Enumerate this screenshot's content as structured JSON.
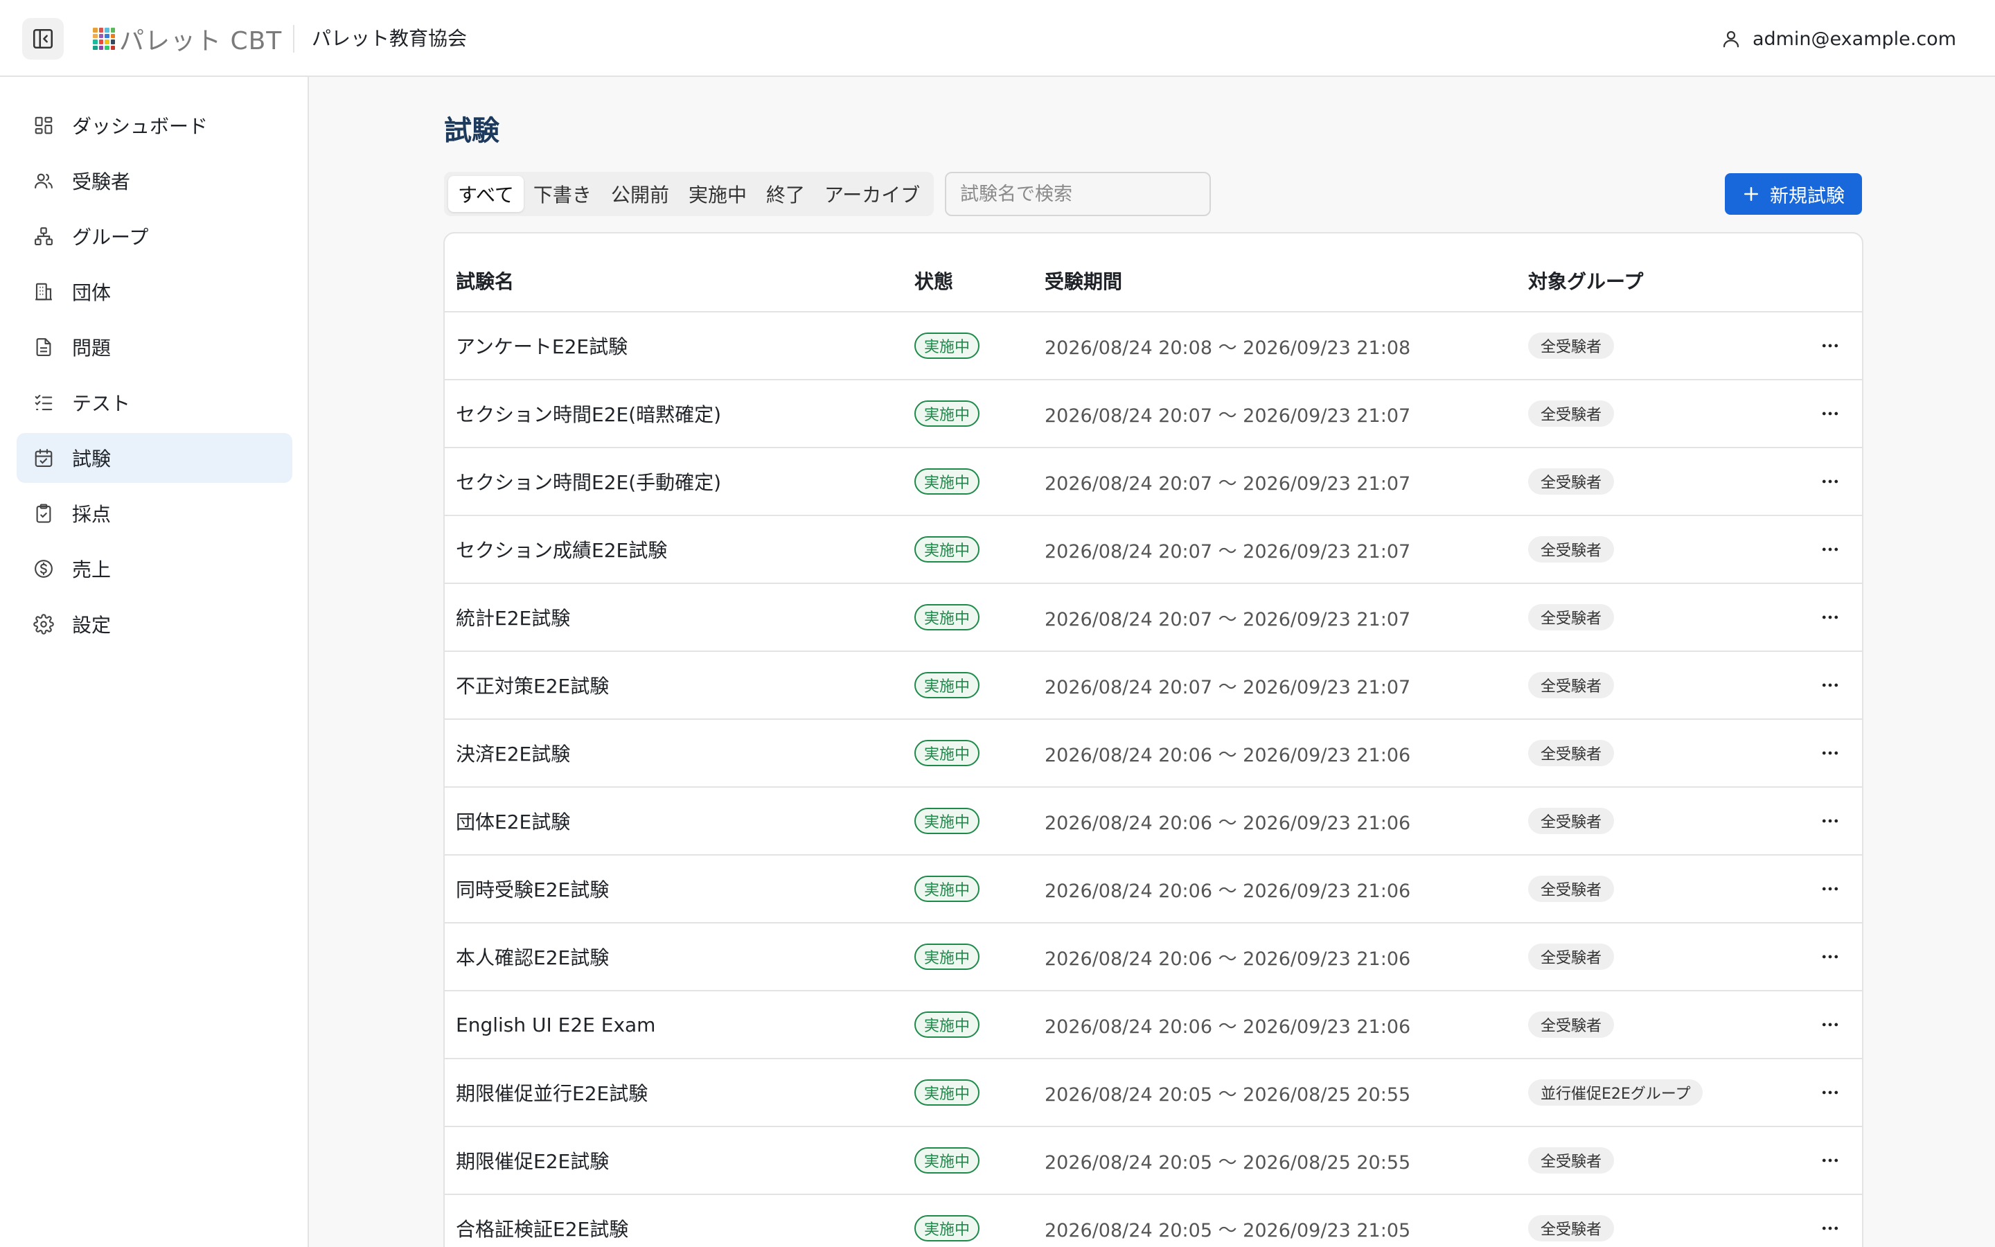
{
  "header": {
    "logo_text": "パレット CBT",
    "org_name": "パレット教育協会",
    "user_email": "admin@example.com"
  },
  "sidebar": {
    "items": [
      {
        "label": "ダッシュボード",
        "icon": "dashboard-icon"
      },
      {
        "label": "受験者",
        "icon": "users-icon"
      },
      {
        "label": "グループ",
        "icon": "group-icon"
      },
      {
        "label": "団体",
        "icon": "building-icon"
      },
      {
        "label": "問題",
        "icon": "document-icon"
      },
      {
        "label": "テスト",
        "icon": "checklist-icon"
      },
      {
        "label": "試験",
        "icon": "calendar-icon"
      },
      {
        "label": "採点",
        "icon": "clipboard-check-icon"
      },
      {
        "label": "売上",
        "icon": "dollar-icon"
      },
      {
        "label": "設定",
        "icon": "gear-icon"
      }
    ],
    "active_item": "試験"
  },
  "main": {
    "title": "試験",
    "tabs": [
      "すべて",
      "下書き",
      "公開前",
      "実施中",
      "終了",
      "アーカイブ"
    ],
    "active_tab": "すべて",
    "search_placeholder": "試験名で検索",
    "new_button_label": "新規試験",
    "table": {
      "columns": [
        "試験名",
        "状態",
        "受験期間",
        "対象グループ"
      ],
      "rows": [
        {
          "name": "アンケートE2E試験",
          "status": "実施中",
          "period": "2026/08/24 20:08 〜 2026/09/23 21:08",
          "group": "全受験者"
        },
        {
          "name": "セクション時間E2E(暗黙確定)",
          "status": "実施中",
          "period": "2026/08/24 20:07 〜 2026/09/23 21:07",
          "group": "全受験者"
        },
        {
          "name": "セクション時間E2E(手動確定)",
          "status": "実施中",
          "period": "2026/08/24 20:07 〜 2026/09/23 21:07",
          "group": "全受験者"
        },
        {
          "name": "セクション成績E2E試験",
          "status": "実施中",
          "period": "2026/08/24 20:07 〜 2026/09/23 21:07",
          "group": "全受験者"
        },
        {
          "name": "統計E2E試験",
          "status": "実施中",
          "period": "2026/08/24 20:07 〜 2026/09/23 21:07",
          "group": "全受験者"
        },
        {
          "name": "不正対策E2E試験",
          "status": "実施中",
          "period": "2026/08/24 20:07 〜 2026/09/23 21:07",
          "group": "全受験者"
        },
        {
          "name": "決済E2E試験",
          "status": "実施中",
          "period": "2026/08/24 20:06 〜 2026/09/23 21:06",
          "group": "全受験者"
        },
        {
          "name": "団体E2E試験",
          "status": "実施中",
          "period": "2026/08/24 20:06 〜 2026/09/23 21:06",
          "group": "全受験者"
        },
        {
          "name": "同時受験E2E試験",
          "status": "実施中",
          "period": "2026/08/24 20:06 〜 2026/09/23 21:06",
          "group": "全受験者"
        },
        {
          "name": "本人確認E2E試験",
          "status": "実施中",
          "period": "2026/08/24 20:06 〜 2026/09/23 21:06",
          "group": "全受験者"
        },
        {
          "name": "English UI E2E Exam",
          "status": "実施中",
          "period": "2026/08/24 20:06 〜 2026/09/23 21:06",
          "group": "全受験者"
        },
        {
          "name": "期限催促並行E2E試験",
          "status": "実施中",
          "period": "2026/08/24 20:05 〜 2026/08/25 20:55",
          "group": "並行催促E2Eグループ"
        },
        {
          "name": "期限催促E2E試験",
          "status": "実施中",
          "period": "2026/08/24 20:05 〜 2026/08/25 20:55",
          "group": "全受験者"
        },
        {
          "name": "合格証検証E2E試験",
          "status": "実施中",
          "period": "2026/08/24 20:05 〜 2026/09/23 21:05",
          "group": "全受験者"
        }
      ]
    }
  },
  "colors": {
    "accent": "#1868db",
    "title": "#1d3a5c",
    "status_active": "#1e8a4a",
    "sidebar_active_bg": "#e9f1fb"
  }
}
